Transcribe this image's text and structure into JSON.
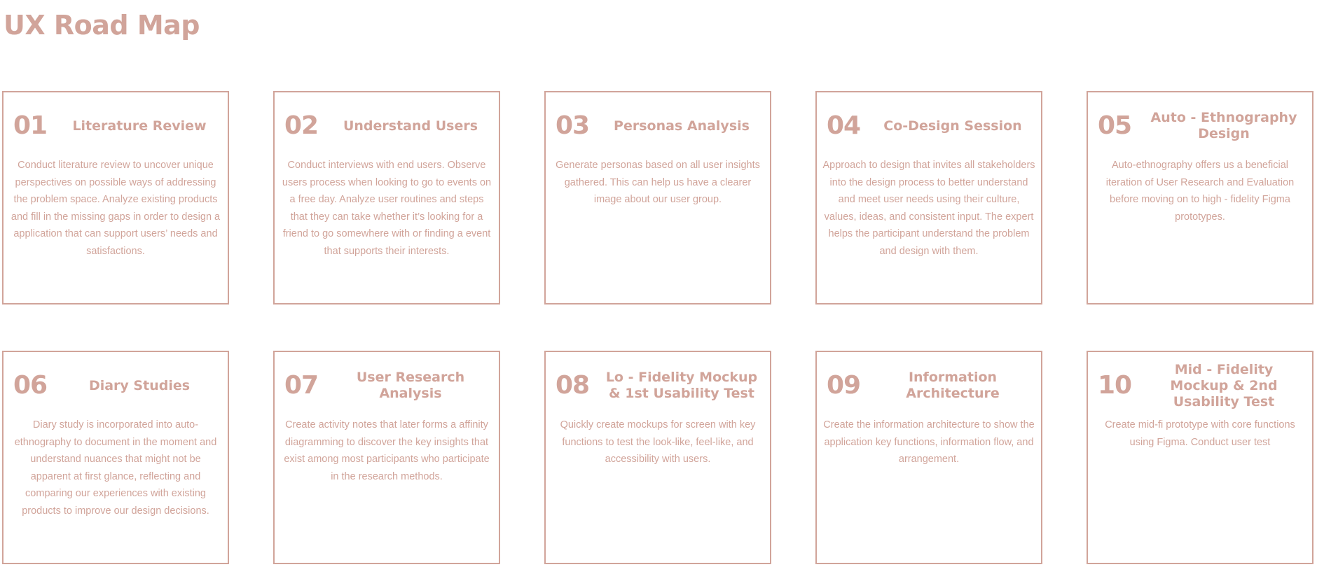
{
  "page": {
    "title": "UX Road Map"
  },
  "colors": {
    "accent": "#d1a49a",
    "background": "#ffffff"
  },
  "steps": [
    {
      "number": "01",
      "title": "Literature Review",
      "description": "Conduct literature review to uncover unique perspectives on possible ways of addressing the problem space.  Analyze existing products and fill in the missing gaps in order to design a application that can support users’ needs and satisfactions."
    },
    {
      "number": "02",
      "title": "Understand Users",
      "description": "Conduct interviews with end users. Observe users process when looking to go to events on a free day. Analyze user routines and steps that they can take whether it’s looking for a friend to go somewhere with or finding a event that supports their interests."
    },
    {
      "number": "03",
      "title": "Personas Analysis",
      "description": "Generate personas based on all user insights gathered. This can help us have a clearer image about our user group."
    },
    {
      "number": "04",
      "title": "Co-Design Session",
      "description": "Approach to design that invites all stakeholders into the design process to better understand and meet user needs using their culture, values, ideas, and consistent input. The expert helps the participant understand the problem and design with them."
    },
    {
      "number": "05",
      "title": "Auto - Ethnography Design",
      "description": "Auto-ethnography offers us a beneficial iteration of User Research and Evaluation before moving on to high - fidelity Figma prototypes."
    },
    {
      "number": "06",
      "title": "Diary Studies",
      "description": "Diary study is incorporated into auto-ethnography to document in the moment and understand nuances that might not be apparent at first glance, reflecting and comparing our experiences with existing products to improve our design decisions."
    },
    {
      "number": "07",
      "title": "User Research Analysis",
      "description": "Create activity notes that later forms a affinity diagramming to discover the key insights that exist among most participants who participate in the research methods."
    },
    {
      "number": "08",
      "title": "Lo - Fidelity Mockup & 1st Usability Test",
      "description": "Quickly create mockups for screen with key functions to test the look-like, feel-like, and accessibility with users."
    },
    {
      "number": "09",
      "title": "Information Architecture",
      "description": "Create the information architecture to show the application key functions, information flow, and arrangement."
    },
    {
      "number": "10",
      "title": "Mid - Fidelity Mockup & 2nd Usability Test",
      "description": "Create mid-fi prototype with core functions using Figma. Conduct user test"
    }
  ]
}
